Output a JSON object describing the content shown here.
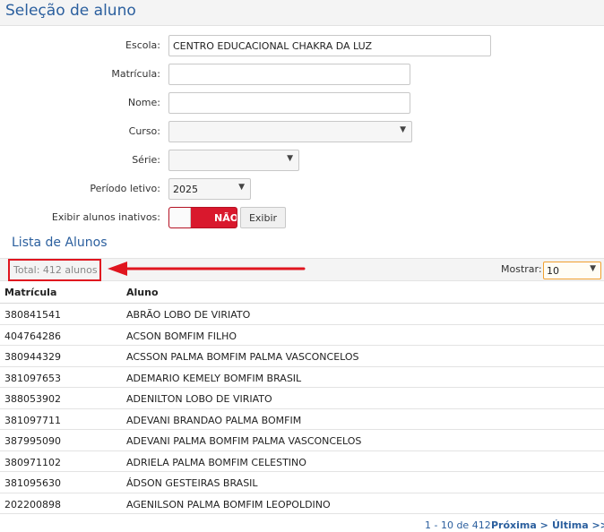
{
  "header": {
    "title": "Seleção de aluno"
  },
  "form": {
    "escola": {
      "label": "Escola:",
      "value": "CENTRO EDUCACIONAL CHAKRA DA LUZ"
    },
    "matricula": {
      "label": "Matrícula:",
      "value": ""
    },
    "nome": {
      "label": "Nome:",
      "value": ""
    },
    "curso": {
      "label": "Curso:",
      "value": ""
    },
    "serie": {
      "label": "Série:",
      "value": ""
    },
    "periodo": {
      "label": "Período letivo:",
      "value": "2025"
    },
    "inativos": {
      "label": "Exibir alunos inativos:",
      "toggle_text": "NÃO",
      "button": "Exibir"
    }
  },
  "list": {
    "title": "Lista de Alunos",
    "total": "Total: 412 alunos",
    "mostrar_label": "Mostrar:",
    "mostrar_value": "10",
    "annotation_color": "#e0151f",
    "columns": [
      "Matrícula",
      "Aluno"
    ],
    "rows": [
      [
        "380841541",
        "ABRÃO LOBO DE VIRIATO"
      ],
      [
        "404764286",
        "ACSON BOMFIM FILHO"
      ],
      [
        "380944329",
        "ACSSON PALMA BOMFIM PALMA VASCONCELOS"
      ],
      [
        "381097653",
        "ADEMARIO KEMELY BOMFIM BRASIL"
      ],
      [
        "388053902",
        "ADENILTON LOBO DE VIRIATO"
      ],
      [
        "381097711",
        "ADEVANI BRANDAO PALMA BOMFIM"
      ],
      [
        "387995090",
        "ADEVANI PALMA BOMFIM PALMA VASCONCELOS"
      ],
      [
        "380971102",
        "ADRIELA PALMA BOMFIM CELESTINO"
      ],
      [
        "381095630",
        "ÁDSON GESTEIRAS BRASIL"
      ],
      [
        "202200898",
        "AGENILSON PALMA BOMFIM LEOPOLDINO"
      ]
    ]
  },
  "pagination": {
    "range": "1 - 10 de 412",
    "next": "Próxima >",
    "last": "Última >>|"
  },
  "icons": {
    "dropdown": "▼"
  }
}
